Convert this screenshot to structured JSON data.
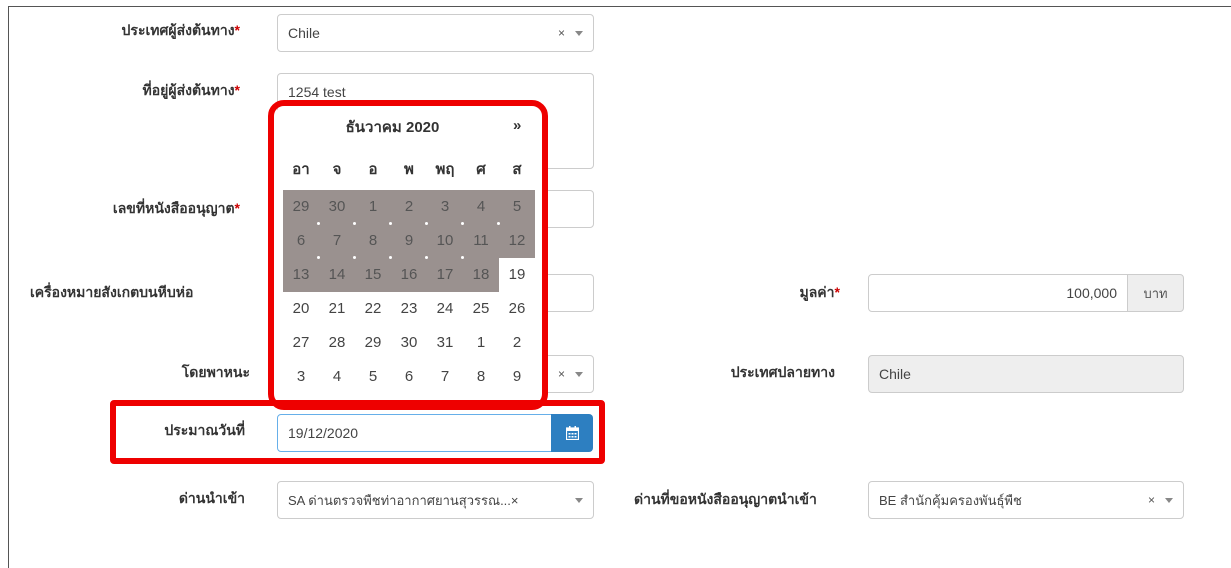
{
  "form": {
    "origin_country": {
      "label": "ประเทศผู้ส่งต้นทาง",
      "required": "*",
      "value": "Chile"
    },
    "origin_address": {
      "label": "ที่อยู่ผู้ส่งต้นทาง",
      "required": "*",
      "value": "1254 test"
    },
    "permit_number": {
      "label": "เลขที่หนังสืออนุญาต",
      "required": "*"
    },
    "package_marks": {
      "label": "เครื่องหมายสังเกตบนหีบห่อ"
    },
    "value": {
      "label": "มูลค่า",
      "required": "*",
      "value": "100,000",
      "unit": "บาท"
    },
    "vehicle": {
      "label": "โดยพาหนะ"
    },
    "destination_country": {
      "label": "ประเทศปลายทาง",
      "value": "Chile"
    },
    "estimated_date": {
      "label": "ประมาณวันที่",
      "value": "19/12/2020"
    },
    "import_checkpoint": {
      "label": "ด่านนำเข้า",
      "value": "SA ด่านตรวจพืชท่าอากาศยานสุวรรณ...×"
    },
    "permit_checkpoint": {
      "label": "ด่านที่ขอหนังสืออนุญาตนำเข้า",
      "value": "BE สำนักคุ้มครองพันธุ์พืช"
    }
  },
  "datepicker": {
    "title": "ธันวาคม 2020",
    "next": "»",
    "weekdays": [
      "อา",
      "จ",
      "อ",
      "พ",
      "พฤ",
      "ศ",
      "ส"
    ],
    "weeks": [
      [
        "29",
        "30",
        "1",
        "2",
        "3",
        "4",
        "5"
      ],
      [
        "6",
        "7",
        "8",
        "9",
        "10",
        "11",
        "12"
      ],
      [
        "13",
        "14",
        "15",
        "16",
        "17",
        "18",
        "19"
      ],
      [
        "20",
        "21",
        "22",
        "23",
        "24",
        "25",
        "26"
      ],
      [
        "27",
        "28",
        "29",
        "30",
        "31",
        "1",
        "2"
      ],
      [
        "3",
        "4",
        "5",
        "6",
        "7",
        "8",
        "9"
      ]
    ]
  },
  "icons": {
    "calendar": "calendar-icon",
    "clear": "clear-icon",
    "caret": "caret-down-icon"
  },
  "colors": {
    "required": "#cc0000",
    "highlight": "#e00000",
    "button": "#2d7fc1",
    "selected_range": "#9a918f"
  }
}
